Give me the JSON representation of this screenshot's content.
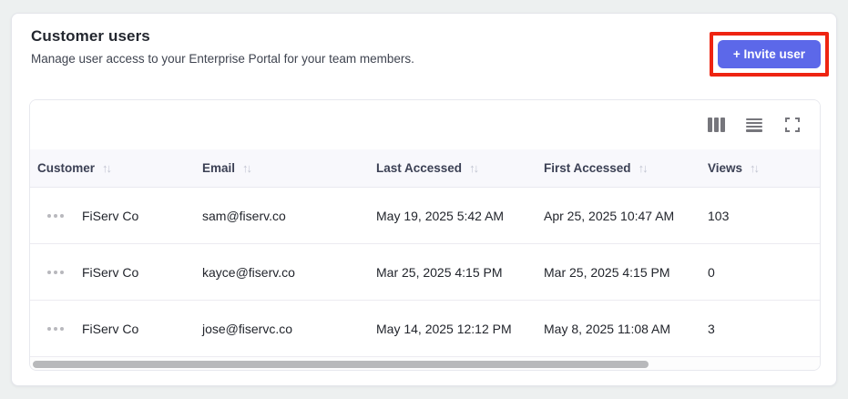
{
  "header": {
    "title": "Customer users",
    "subtitle": "Manage user access to your Enterprise Portal for your team members.",
    "invite_button_label": "+ Invite user"
  },
  "toolbar": {
    "icons": [
      "columns-icon",
      "row-density-icon",
      "fullscreen-icon"
    ]
  },
  "table": {
    "sort_glyph": "↑↓",
    "columns": [
      {
        "label": "Customer"
      },
      {
        "label": "Email"
      },
      {
        "label": "Last Accessed"
      },
      {
        "label": "First Accessed"
      },
      {
        "label": "Views"
      }
    ],
    "rows": [
      {
        "customer": "FiServ Co",
        "email": "sam@fiserv.co",
        "last_accessed": "May 19, 2025 5:42 AM",
        "first_accessed": "Apr 25, 2025 10:47 AM",
        "views": "103"
      },
      {
        "customer": "FiServ Co",
        "email": "kayce@fiserv.co",
        "last_accessed": "Mar 25, 2025 4:15 PM",
        "first_accessed": "Mar 25, 2025 4:15 PM",
        "views": "0"
      },
      {
        "customer": "FiServ Co",
        "email": "jose@fiservc.co",
        "last_accessed": "May 14, 2025 12:12 PM",
        "first_accessed": "May 8, 2025 11:08 AM",
        "views": "3"
      }
    ]
  },
  "colors": {
    "accent_button": "#5c68e9",
    "highlight_red": "#ee2411",
    "header_row_bg": "#f8f8fc",
    "page_bg": "#edf0f0"
  }
}
